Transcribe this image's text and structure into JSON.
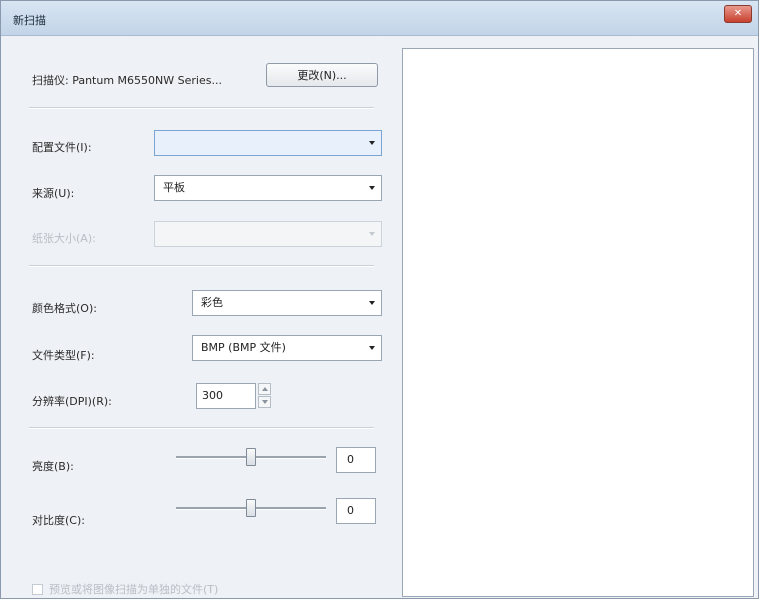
{
  "window": {
    "title": "新扫描",
    "close_icon": "close-icon"
  },
  "scanner": {
    "label": "扫描仪: Pantum M6550NW Series...",
    "change_button": "更改(N)..."
  },
  "profile": {
    "label": "配置文件(I):",
    "value": ""
  },
  "source": {
    "label": "来源(U):",
    "value": "平板"
  },
  "paper_size": {
    "label": "纸张大小(A):",
    "value": ""
  },
  "color_format": {
    "label": "颜色格式(O):",
    "value": "彩色"
  },
  "file_type": {
    "label": "文件类型(F):",
    "value": "BMP (BMP 文件)"
  },
  "resolution": {
    "label": "分辨率(DPI)(R):",
    "value": "300"
  },
  "brightness": {
    "label": "亮度(B):",
    "value": "0",
    "level": 0.5
  },
  "contrast": {
    "label": "对比度(C):",
    "value": "0",
    "level": 0.5
  },
  "separate_files": {
    "label": "预览或将图像扫描为单独的文件(T)",
    "checked": false
  }
}
